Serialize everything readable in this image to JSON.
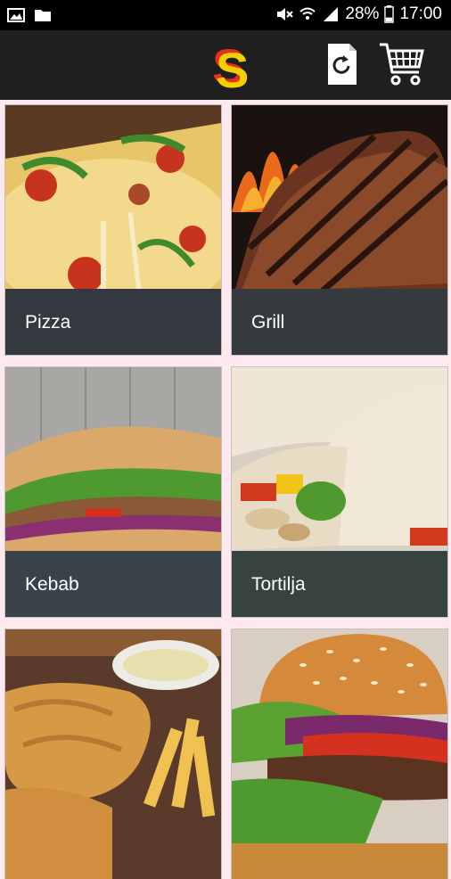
{
  "status_bar": {
    "battery": "28%",
    "time": "17:00",
    "icons": [
      "image-icon",
      "folder-icon",
      "mute-icon",
      "wifi-icon",
      "signal-icon",
      "battery-icon"
    ]
  },
  "app_bar": {
    "logo_letter": "S",
    "icons": [
      "history-icon",
      "cart-icon"
    ]
  },
  "colors": {
    "status_bar_bg": "#000000",
    "app_bar_bg": "#1f1f1f",
    "page_bg": "#fde9ee",
    "label_overlay": "#343e46",
    "logo_red": "#e53020",
    "logo_yellow": "#f5d000"
  },
  "categories": [
    {
      "label": "Pizza"
    },
    {
      "label": "Grill"
    },
    {
      "label": "Kebab"
    },
    {
      "label": "Tortilja"
    },
    {
      "label": ""
    },
    {
      "label": ""
    }
  ]
}
